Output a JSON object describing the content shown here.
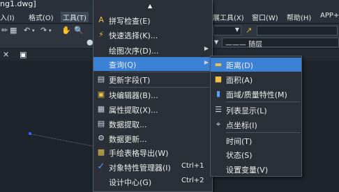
{
  "window": {
    "title": "ng1.dwg]"
  },
  "menubar": {
    "items": [
      "入(I)",
      "格式(O)",
      "工具(T)",
      "展工具(X)",
      "窗口(W)",
      "帮助(H)",
      "APP+"
    ]
  },
  "toolbar": {
    "layer_label": "随层"
  },
  "tools_menu": {
    "items": [
      {
        "icon": "spell-check-icon",
        "label": "拼写检查(E)",
        "shortcut": "",
        "submenu": false
      },
      {
        "icon": "quick-select-icon",
        "label": "快速选择(K)...",
        "shortcut": "",
        "submenu": false
      },
      {
        "icon": "",
        "label": "绘图次序(D)...",
        "shortcut": "",
        "submenu": true
      },
      {
        "icon": "",
        "label": "查询(Q)",
        "shortcut": "",
        "submenu": true
      },
      {
        "icon": "update-field-icon",
        "label": "更新字段(T)",
        "shortcut": "",
        "submenu": false
      },
      {
        "icon": "block-editor-icon",
        "label": "块编辑器(B)...",
        "shortcut": "",
        "submenu": false
      },
      {
        "icon": "attribute-extract-icon",
        "label": "属性提取(X)...",
        "shortcut": "",
        "submenu": false
      },
      {
        "icon": "data-extract-icon",
        "label": "数据提取...",
        "shortcut": "",
        "submenu": false
      },
      {
        "icon": "data-update-icon",
        "label": "数据更新...",
        "shortcut": "",
        "submenu": false
      },
      {
        "icon": "table-export-icon",
        "label": "手绘表格导出(W)",
        "shortcut": "",
        "submenu": false
      },
      {
        "icon": "checkmark-icon",
        "label": "对象特性管理器(I)",
        "shortcut": "Ctrl+1",
        "submenu": false
      },
      {
        "icon": "",
        "label": "设计中心(G)",
        "shortcut": "Ctrl+2",
        "submenu": false
      }
    ]
  },
  "query_submenu": {
    "items": [
      {
        "icon": "distance-icon",
        "label": "距离(D)"
      },
      {
        "icon": "area-icon",
        "label": "面积(A)"
      },
      {
        "icon": "region-mass-icon",
        "label": "面域/质量特性(M)"
      },
      {
        "icon": "list-icon",
        "label": "列表显示(L)"
      },
      {
        "icon": "point-coord-icon",
        "label": "点坐标(I)"
      },
      {
        "icon": "",
        "label": "时间(T)"
      },
      {
        "icon": "",
        "label": "状态(S)"
      },
      {
        "icon": "",
        "label": "设置变量(V)"
      }
    ]
  }
}
